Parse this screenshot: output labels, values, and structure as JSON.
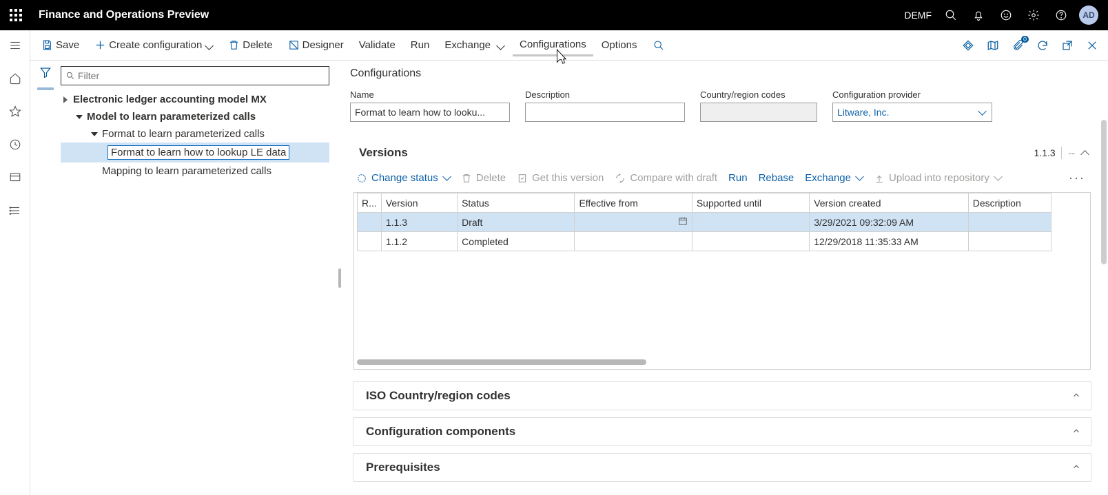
{
  "topbar": {
    "title": "Finance and Operations Preview",
    "company": "DEMF",
    "avatar": "AD"
  },
  "toolbar": {
    "save": "Save",
    "create": "Create configuration",
    "delete": "Delete",
    "designer": "Designer",
    "validate": "Validate",
    "run": "Run",
    "exchange": "Exchange",
    "configurations": "Configurations",
    "options": "Options",
    "badge0": "0"
  },
  "filter": {
    "placeholder": "Filter"
  },
  "tree": {
    "n1": "Electronic ledger accounting model MX",
    "n2": "Model to learn parameterized calls",
    "n3": "Format to learn parameterized calls",
    "n4": "Format to learn how to lookup LE data",
    "n5": "Mapping to learn parameterized calls"
  },
  "detail": {
    "heading": "Configurations",
    "fields": {
      "name_label": "Name",
      "name_value": "Format to learn how to looku...",
      "desc_label": "Description",
      "desc_value": "",
      "region_label": "Country/region codes",
      "region_value": "",
      "provider_label": "Configuration provider",
      "provider_value": "Litware, Inc."
    }
  },
  "versions": {
    "title": "Versions",
    "meta": "1.1.3",
    "dash": "--",
    "toolbar": {
      "change_status": "Change status",
      "delete": "Delete",
      "get_version": "Get this version",
      "compare": "Compare with draft",
      "run": "Run",
      "rebase": "Rebase",
      "exchange": "Exchange",
      "upload": "Upload into repository"
    },
    "columns": {
      "r": "R...",
      "version": "Version",
      "status": "Status",
      "effective": "Effective from",
      "supported": "Supported until",
      "created": "Version created",
      "desc": "Description"
    },
    "rows": [
      {
        "version": "1.1.3",
        "status": "Draft",
        "effective": "",
        "supported": "",
        "created": "3/29/2021 09:32:09 AM",
        "desc": ""
      },
      {
        "version": "1.1.2",
        "status": "Completed",
        "effective": "",
        "supported": "",
        "created": "12/29/2018 11:35:33 AM",
        "desc": ""
      }
    ]
  },
  "sections": {
    "iso": "ISO Country/region codes",
    "components": "Configuration components",
    "prereq": "Prerequisites"
  }
}
